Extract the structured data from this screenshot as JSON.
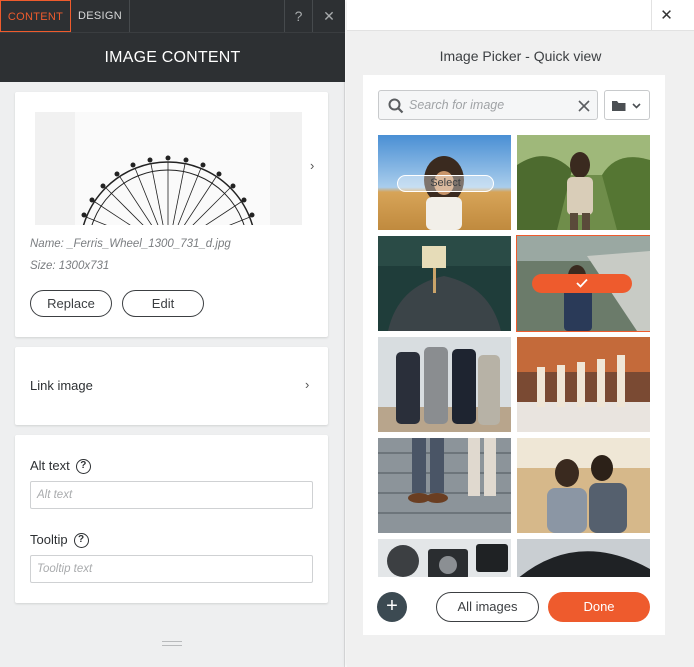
{
  "left": {
    "tabs": [
      {
        "label": "CONTENT"
      },
      {
        "label": "DESIGN"
      }
    ],
    "help": "?",
    "close": "✕",
    "header_title": "IMAGE CONTENT",
    "image": {
      "name": "Name: _Ferris_Wheel_1300_731_d.jpg",
      "size": "Size: 1300x731",
      "replace_label": "Replace",
      "edit_label": "Edit"
    },
    "link": {
      "label": "Link image"
    },
    "alt": {
      "label": "Alt text",
      "placeholder": "Alt text"
    },
    "tooltip": {
      "label": "Tooltip",
      "placeholder": "Tooltip text"
    }
  },
  "picker": {
    "title": "Image Picker - Quick view",
    "close": "✕",
    "search_placeholder": "Search for image",
    "select_label": "Select",
    "all_images_label": "All images",
    "done_label": "Done",
    "add_label": "+"
  },
  "colors": {
    "accent": "#ee5b2d",
    "dark": "#2d3033"
  }
}
